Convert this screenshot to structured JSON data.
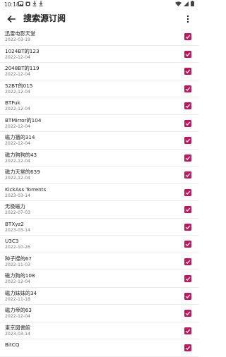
{
  "status_bar": {
    "time": "10:18",
    "left_icons": [
      "image-icon",
      "notification-icon",
      "download-icon",
      "download-icon"
    ],
    "right_icons": [
      "wifi-icon",
      "signal-icon",
      "battery-icon"
    ]
  },
  "app_bar": {
    "title": "搜索源订阅",
    "back_icon": "arrow-back-icon",
    "menu_icon": "more-vert-icon"
  },
  "accent_color": "#c2185b",
  "items": [
    {
      "name": "迅雷电影天堂",
      "date": "2022-03-19",
      "checked": true
    },
    {
      "name": "1024BT的123",
      "date": "2022-12-04",
      "checked": true
    },
    {
      "name": "2048BT的119",
      "date": "2022-12-04",
      "checked": true
    },
    {
      "name": "52BT的015",
      "date": "2022-12-04",
      "checked": true
    },
    {
      "name": "BTFuk",
      "date": "2022-12-04",
      "checked": true
    },
    {
      "name": "BTMirror的104",
      "date": "2022-12-04",
      "checked": true
    },
    {
      "name": "磁力猫的314",
      "date": "2022-12-04",
      "checked": true
    },
    {
      "name": "磁力狗狗的43",
      "date": "2022-12-04",
      "checked": true
    },
    {
      "name": "磁力天堂的639",
      "date": "2022-12-04",
      "checked": true
    },
    {
      "name": "KickAss Torrents",
      "date": "2023-03-14",
      "checked": true
    },
    {
      "name": "无极磁力",
      "date": "2022-07-03",
      "checked": true
    },
    {
      "name": "BTXyz2",
      "date": "2023-03-14",
      "checked": true
    },
    {
      "name": "U3C3",
      "date": "2022-10-26",
      "checked": true
    },
    {
      "name": "种子搜的67",
      "date": "2022-11-03",
      "checked": true
    },
    {
      "name": "磁力狗的108",
      "date": "2022-12-04",
      "checked": true
    },
    {
      "name": "磁力妹妹的34",
      "date": "2022-11-18",
      "checked": true
    },
    {
      "name": "磁力帝的63",
      "date": "2022-12-04",
      "checked": true
    },
    {
      "name": "東京図書館",
      "date": "2023-03-14",
      "checked": true
    },
    {
      "name": "BitCQ",
      "date": "",
      "checked": true
    }
  ]
}
